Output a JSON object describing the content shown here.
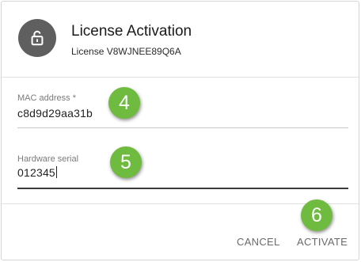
{
  "dialog": {
    "title": "License Activation",
    "subtitle": "License V8WJNEE89Q6A",
    "header_icon": "unlock-icon"
  },
  "fields": {
    "mac": {
      "label": "MAC address *",
      "value": "c8d9d29aa31b"
    },
    "hardware": {
      "label": "Hardware serial",
      "value": "012345"
    }
  },
  "steps": [
    "4",
    "5",
    "6"
  ],
  "actions": {
    "cancel": "CANCEL",
    "activate": "ACTIVATE"
  },
  "colors": {
    "step_badge": "#6fbb3f",
    "icon_bg": "#5f5f5f"
  }
}
